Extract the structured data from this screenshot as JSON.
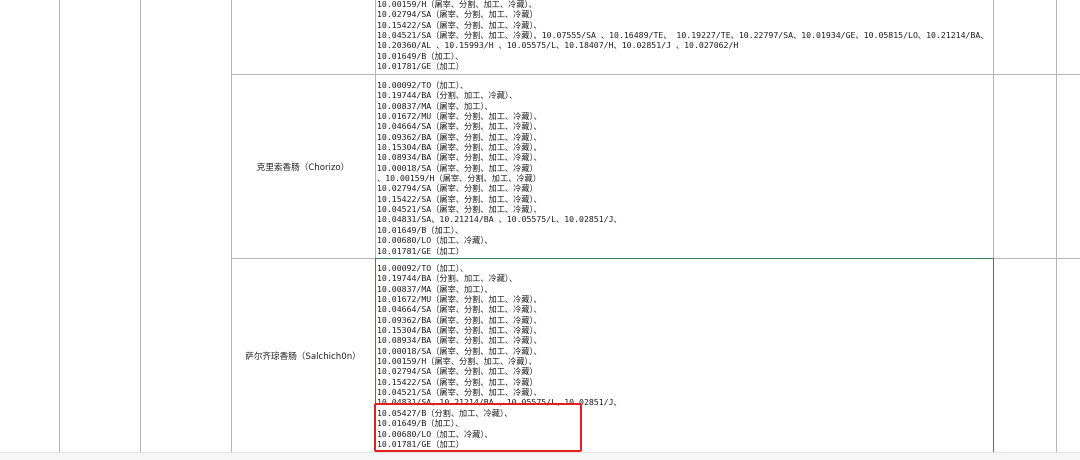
{
  "rows": [
    {
      "name": "",
      "lines": [
        "10.00159/H（屠宰、分割、加工、冷藏）、",
        "10.02794/SA（屠宰、分割、加工、冷藏）",
        "10.15422/SA（屠宰、分割、加工、冷藏）、",
        "10.04521/SA（屠宰、分割、加工、冷藏）、10.07555/SA 、10.16489/TE、 10.19227/TE、10.22797/SA、10.01934/GE、10.05815/LO、10.21214/BA、",
        "10.20360/AL 、10.15993/H 、10.05575/L、10.18407/H、10.02851/J 、10.027062/H",
        "10.01649/B（加工）、",
        "10.01781/GE（加工）"
      ]
    },
    {
      "name": "克里索香肠（Chorizo）",
      "lines": [
        "10.00092/TO（加工）、",
        "10.19744/BA（分割、加工、冷藏）、",
        "10.00837/MA（屠宰、加工）、",
        "10.01672/MU（屠宰、分割、加工、冷藏）、",
        "10.04664/SA（屠宰、分割、加工、冷藏）、",
        "10.09362/BA（屠宰、分割、加工、冷藏）、",
        "10.15304/BA（屠宰、分割、加工、冷藏）、",
        "10.08934/BA（屠宰、分割、加工、冷藏）、",
        "10.00018/SA（屠宰、分割、加工、冷藏）",
        "、10.00159/H（屠宰、分割、加工、冷藏）",
        "10.02794/SA（屠宰、分割、加工、冷藏）",
        "10.15422/SA（屠宰、分割、加工、冷藏）、",
        "10.04521/SA（屠宰、分割、加工、冷藏）、",
        "10.04831/SA、10.21214/BA 、10.05575/L、10.02851/J、",
        "10.01649/B（加工）、",
        "10.00680/LO（加工、冷藏）、",
        "10.01781/GE（加工）"
      ]
    },
    {
      "name": "萨尔齐琼香肠（Salchich0n）",
      "lines": [
        "10.00092/TO（加工）、",
        "10.19744/BA（分割、加工、冷藏）、",
        "10.00837/MA（屠宰、加工）、",
        "10.01672/MU（屠宰、分割、加工、冷藏）、",
        "10.04664/SA（屠宰、分割、加工、冷藏）、",
        "10.09362/BA（屠宰、分割、加工、冷藏）、",
        "10.15304/BA（屠宰、分割、加工、冷藏）、",
        "10.08934/BA（屠宰、分割、加工、冷藏）、",
        "10.00018/SA（屠宰、分割、加工、冷藏）、",
        "10.00159/H（屠宰、分割、加工、冷藏）、",
        "10.02794/SA（屠宰、分割、加工、冷藏）",
        "10.15422/SA（屠宰、分割、加工、冷藏）",
        "10.04521/SA（屠宰、分割、加工、冷藏）、",
        "10.04831/SA、10.21214/BA 、10.05575/L、10.02851/J、",
        "10.05427/B（分割、加工、冷藏）、",
        "10.01649/B（加工）、",
        "10.00680/LO（加工、冷藏）、",
        "10.01781/GE（加工）"
      ]
    }
  ],
  "colors": {
    "grid": "#b5b5b5",
    "selection": "#2e8b57",
    "highlight": "#e0211d"
  }
}
